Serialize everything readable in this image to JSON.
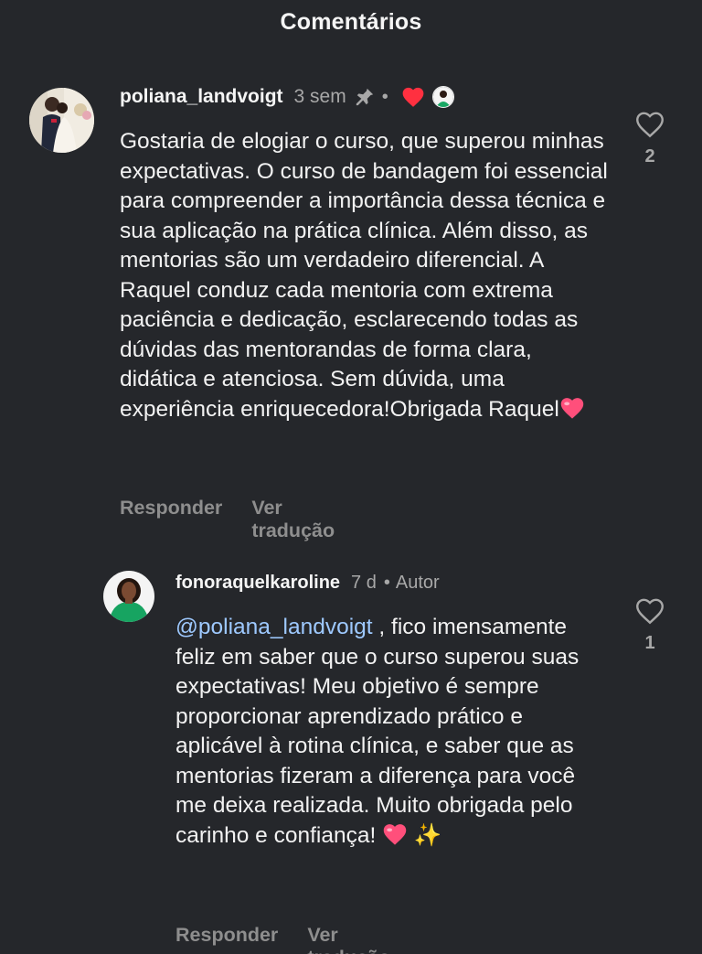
{
  "header": {
    "title": "Comentários"
  },
  "comments": [
    {
      "username": "poliana_landvoigt",
      "time": "3 sem",
      "pinned_icon": "pin-icon",
      "dot": "•",
      "liked_by_author_icon": "heart-filled-icon",
      "text": "Gostaria de elogiar o curso, que superou minhas expectativas. O curso de bandagem foi essencial para compreender a importância dessa técnica e sua aplicação na prática clínica. Além disso, as mentorias são um verdadeiro diferencial. A Raquel conduz cada mentoria com extrema paciência e dedicação, esclarecendo todas as dúvidas das mentorandas de forma clara, didática e atenciosa. Sem dúvida, uma experiência enriquecedora!Obrigada Raquel",
      "reply_label": "Responder",
      "translate_label": "Ver tradução",
      "likes": "2"
    },
    {
      "username": "fonoraquelkaroline",
      "time": "7 d",
      "dot": "•",
      "author_badge": "Autor",
      "mention": "@poliana_landvoigt",
      "text": " , fico imensamente feliz em saber que o curso superou suas expectativas! Meu objetivo é sempre proporcionar aprendizado prático e aplicável à rotina clínica, e saber que as mentorias fizeram a diferença para você me deixa realizada. Muito obrigada pelo carinho e confiança!",
      "sparkle": "✨",
      "reply_label": "Responder",
      "translate_label": "Ver tradução",
      "likes": "1"
    }
  ],
  "colors": {
    "background": "#25272b",
    "text": "#f2f2f2",
    "muted": "#a8a8a8",
    "mention": "#9ec9ff",
    "heart": "#ff3040",
    "emoji_heart": "#ff4f7b"
  }
}
